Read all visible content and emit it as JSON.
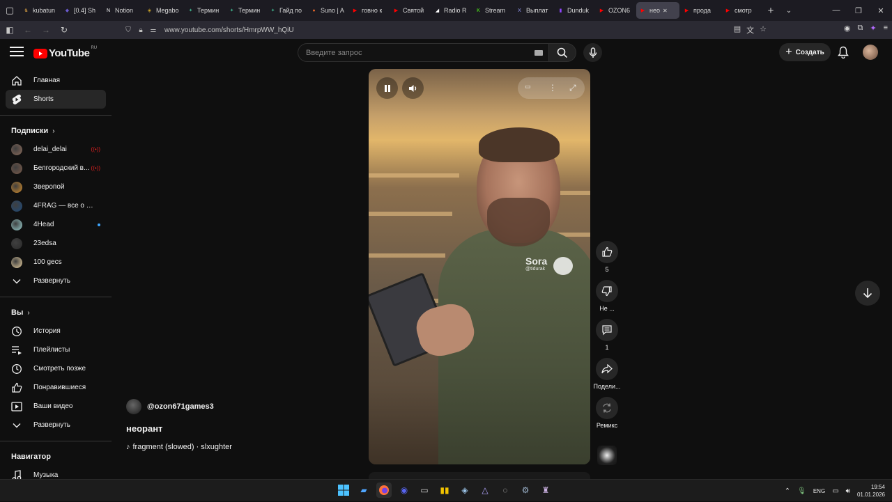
{
  "browser": {
    "tabs": [
      {
        "title": "kubatun",
        "color": "#a57b3a",
        "glyph": "♞"
      },
      {
        "title": "[0.4] Sh",
        "color": "#6a5acd",
        "glyph": "◆"
      },
      {
        "title": "Notion",
        "color": "#ffffff",
        "glyph": "N"
      },
      {
        "title": "Megabo",
        "color": "#c9a227",
        "glyph": "◈"
      },
      {
        "title": "Термин",
        "color": "#3fb28c",
        "glyph": "✦"
      },
      {
        "title": "Термин",
        "color": "#3fb28c",
        "glyph": "✦"
      },
      {
        "title": "Гайд по",
        "color": "#3fb28c",
        "glyph": "✦"
      },
      {
        "title": "Suno | A",
        "color": "#e0632a",
        "glyph": "●"
      },
      {
        "title": "говно к",
        "color": "#ff0000",
        "glyph": "▶"
      },
      {
        "title": "Святой",
        "color": "#ff0000",
        "glyph": "▶"
      },
      {
        "title": "Radio R",
        "color": "#ffffff",
        "glyph": "◢"
      },
      {
        "title": "Stream",
        "color": "#53fc18",
        "glyph": "K"
      },
      {
        "title": "Выплат",
        "color": "#9aa0ff",
        "glyph": "X"
      },
      {
        "title": "Dunduk",
        "color": "#9146ff",
        "glyph": "▮"
      },
      {
        "title": "OZON6",
        "color": "#ff0000",
        "glyph": "▶"
      },
      {
        "title": "нео",
        "color": "#ff0000",
        "glyph": "▶"
      },
      {
        "title": "прода",
        "color": "#ff0000",
        "glyph": "▶"
      },
      {
        "title": "смотр",
        "color": "#ff0000",
        "glyph": "▶"
      }
    ],
    "active_tab_index": 15,
    "url": "www.youtube.com/shorts/HmrpWW_hQiU"
  },
  "youtube": {
    "logo_text": "YouTube",
    "country_code": "RU",
    "search_placeholder": "Введите запрос",
    "create_label": "Создать"
  },
  "sidebar": {
    "main": [
      {
        "label": "Главная",
        "icon": "home-icon"
      },
      {
        "label": "Shorts",
        "icon": "shorts-icon",
        "active": true
      }
    ],
    "subscriptions_header": "Подписки",
    "subscriptions": [
      {
        "label": "delai_delai",
        "badge": "live",
        "color": "#8a6a5a"
      },
      {
        "label": "Белгородский в...",
        "badge": "live",
        "color": "#7a5a4a"
      },
      {
        "label": "Зверопой",
        "badge": "",
        "color": "#d08a2a"
      },
      {
        "label": "4FRAG — все о сов...",
        "badge": "",
        "color": "#1e4a7a"
      },
      {
        "label": "4Head",
        "badge": "dot",
        "color": "#9ad0d0"
      },
      {
        "label": "23edsa",
        "badge": "",
        "color": "#2a2a2a"
      },
      {
        "label": "100 gecs",
        "badge": "",
        "color": "#e8d0a0"
      }
    ],
    "expand_label_1": "Развернуть",
    "you_header": "Вы",
    "you_items": [
      {
        "label": "История",
        "icon": "history-icon"
      },
      {
        "label": "Плейлисты",
        "icon": "playlists-icon"
      },
      {
        "label": "Смотреть позже",
        "icon": "watch-later-icon"
      },
      {
        "label": "Понравившиеся",
        "icon": "liked-icon"
      },
      {
        "label": "Ваши видео",
        "icon": "your-videos-icon"
      }
    ],
    "expand_label_2": "Развернуть",
    "navigator_header": "Навигатор",
    "navigator_items": [
      {
        "label": "Музыка",
        "icon": "music-icon"
      }
    ]
  },
  "video": {
    "channel": "@ozon671games3",
    "title": "неорант",
    "music": "fragment (slowed) · slxughter",
    "watermark_name": "Sora",
    "watermark_handle": "@tidurak"
  },
  "actions": {
    "likes": "5",
    "dislike_label": "Не ...",
    "comments": "1",
    "share_label": "Подели...",
    "remix_label": "Ремикс"
  },
  "taskbar": {
    "lang": "ENG",
    "time": "19:54",
    "date": "01.01.2026"
  }
}
